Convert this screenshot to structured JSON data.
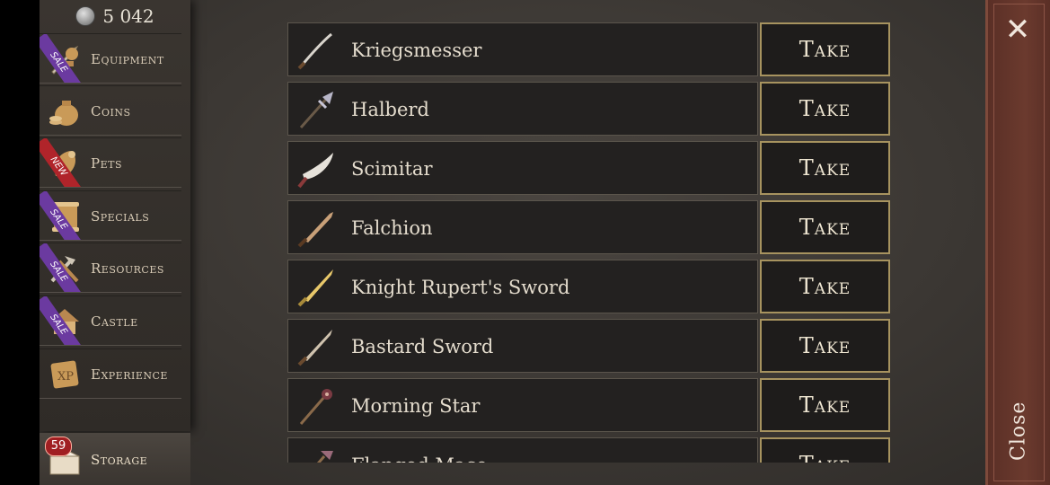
{
  "currency": {
    "amount": "5 042",
    "icon": "silver-coin-icon"
  },
  "sidebar": {
    "items": [
      {
        "label": "Equipment",
        "icon": "sword-icon",
        "ribbon": "SALE",
        "ribbon_type": "sale"
      },
      {
        "label": "Coins",
        "icon": "coin-bag-icon",
        "ribbon": "",
        "ribbon_type": ""
      },
      {
        "label": "Pets",
        "icon": "paw-icon",
        "ribbon": "NEW",
        "ribbon_type": "new"
      },
      {
        "label": "Specials",
        "icon": "scroll-icon",
        "ribbon": "SALE",
        "ribbon_type": "sale"
      },
      {
        "label": "Resources",
        "icon": "tools-icon",
        "ribbon": "SALE",
        "ribbon_type": "sale"
      },
      {
        "label": "Castle",
        "icon": "castle-icon",
        "ribbon": "SALE",
        "ribbon_type": "sale"
      },
      {
        "label": "Experience",
        "icon": "xp-book-icon",
        "ribbon": "",
        "ribbon_type": ""
      }
    ],
    "storage": {
      "label": "Storage",
      "badge": "59",
      "icon": "chest-icon"
    }
  },
  "items": [
    {
      "name": "Kriegsmesser",
      "take": "Take",
      "icon": "kriegsmesser-icon"
    },
    {
      "name": "Halberd",
      "take": "Take",
      "icon": "halberd-icon"
    },
    {
      "name": "Scimitar",
      "take": "Take",
      "icon": "scimitar-icon"
    },
    {
      "name": "Falchion",
      "take": "Take",
      "icon": "falchion-icon"
    },
    {
      "name": "Knight Rupert's Sword",
      "take": "Take",
      "icon": "golden-sword-icon"
    },
    {
      "name": "Bastard Sword",
      "take": "Take",
      "icon": "bastard-sword-icon"
    },
    {
      "name": "Morning Star",
      "take": "Take",
      "icon": "morning-star-icon"
    },
    {
      "name": "Flanged Mace",
      "take": "Take",
      "icon": "flanged-mace-icon"
    }
  ],
  "close": {
    "label": "Close",
    "icon": "close-icon"
  },
  "colors": {
    "accent_gold": "#a7935f",
    "sale_purple": "#6b3aa0",
    "new_red": "#b0242a",
    "close_panel": "#6b3a2e"
  }
}
